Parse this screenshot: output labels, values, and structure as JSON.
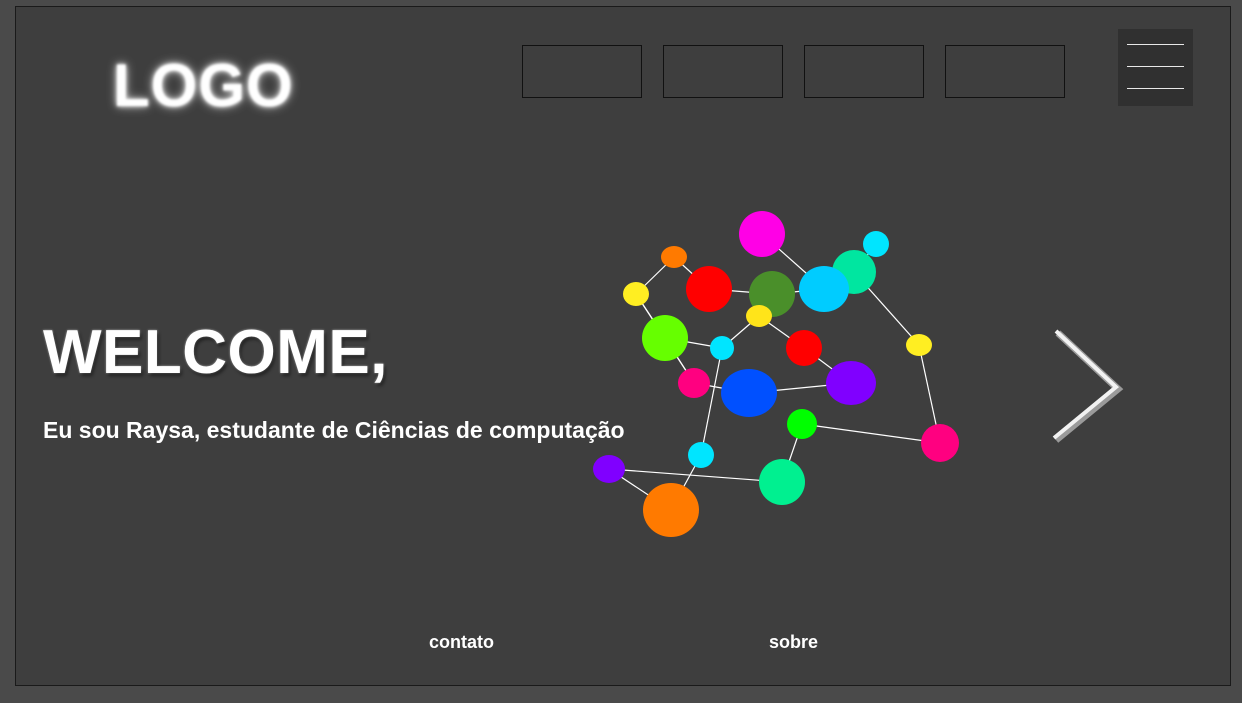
{
  "header": {
    "logo_text": "LOGO",
    "nav_items": [
      "",
      "",
      "",
      ""
    ]
  },
  "hero": {
    "title": "WELCOME,",
    "subtitle": "Eu sou Raysa, estudante de Ciências de computação"
  },
  "footer": {
    "contact_label": "contato",
    "about_label": "sobre"
  },
  "icons": {
    "menu": "hamburger-icon",
    "next": "chevron-right-icon"
  },
  "colors": {
    "background": "#3e3e3e",
    "text": "#ffffff"
  }
}
